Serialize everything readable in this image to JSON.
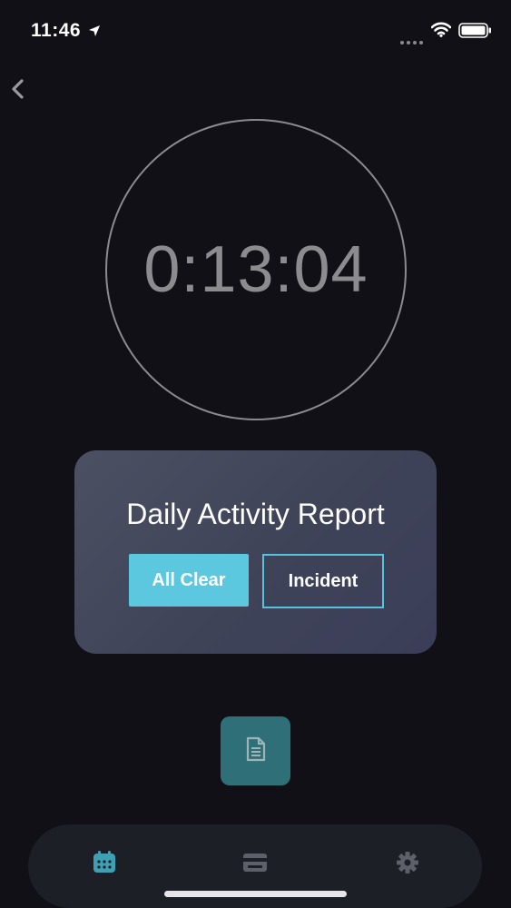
{
  "status_bar": {
    "time": "11:46",
    "icons": [
      "location-arrow-icon",
      "signal-icon",
      "wifi-icon",
      "battery-icon"
    ]
  },
  "navigation": {
    "back_icon": "chevron-left-icon"
  },
  "timer": {
    "value": "0:13:04"
  },
  "report_card": {
    "title": "Daily Activity Report",
    "all_clear_label": "All Clear",
    "incident_label": "Incident"
  },
  "notes_button": {
    "icon": "document-icon"
  },
  "tab_bar": {
    "tabs": [
      {
        "icon": "calendar-icon",
        "active": true
      },
      {
        "icon": "wallet-icon",
        "active": false
      },
      {
        "icon": "gear-icon",
        "active": false
      }
    ]
  },
  "colors": {
    "background": "#101016",
    "accent": "#5cc8e0",
    "card": "#444a5e",
    "tab_active": "#3f9fb3",
    "tab_inactive": "#5d6068"
  }
}
